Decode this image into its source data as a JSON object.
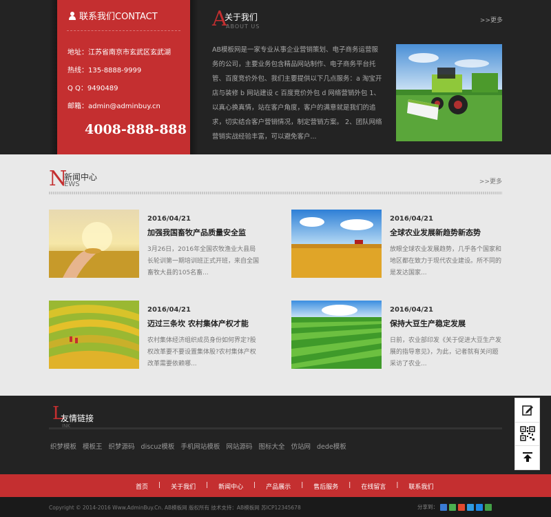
{
  "contact": {
    "title": "联系我们CONTACT",
    "address": "地址：江苏省南京市玄武区玄武湖",
    "hotline_row": "热线：135-8888-9999",
    "qq": "Q Q：9490489",
    "email": "邮箱：admin@adminbuy.cn",
    "phone_big": "4008-888-888"
  },
  "about": {
    "letter": "A",
    "title_cn": "关于我们",
    "title_en": "ABOUT US",
    "more": ">>更多",
    "text": "AB模板网是一家专业从事企业营销策划、电子商务运营服务的公司，主要业务包含精品网站制作、电子商务平台托管、百度竞价外包、我们主要提供以下几点服务：a 淘宝开店与装修 b 网站建设 c 百度竞价外包 d 网络营销外包 1、以真心换真情，站在客户角度，客户的满意就是我们的追求，切实结合客户营销情况，制定营销方案。 2、团队网络营销实战经验丰富，可以避免客户..."
  },
  "news": {
    "letter": "N",
    "title_cn": "新闻中心",
    "title_en": "EWS",
    "more": ">>更多",
    "items": [
      {
        "date": "2016/04/21",
        "title": "加强我国畜牧产品质量安全监",
        "summary": "3月26日，2016年全国农牧渔业大县局长轮训第一期培训班正式开班，来自全国畜牧大县的105名畜..."
      },
      {
        "date": "2016/04/21",
        "title": "全球农业发展新趋势新态势",
        "summary": "放眼全球农业发展趋势，几乎各个国家和地区都在致力于现代农业建设。所不同的是发达国家..."
      },
      {
        "date": "2016/04/21",
        "title": "迈过三条坎 农村集体产权才能",
        "summary": "农村集体经济组织成员身份如何界定?股权改革要不要设置集体股?农村集体产权改革需要依赖哪..."
      },
      {
        "date": "2016/04/21",
        "title": "保持大豆生产稳定发展",
        "summary": "日前，农业部印发《关于促进大豆生产发展的指导意见》，为此，记者就有关问题采访了农业..."
      }
    ]
  },
  "links": {
    "letter": "L",
    "title_cn": "友情链接",
    "title_en": "INK",
    "items": [
      "织梦模板",
      "模板王",
      "织梦源码",
      "discuz模板",
      "手机网站模板",
      "网站源码",
      "图标大全",
      "仿站网",
      "dede模板"
    ]
  },
  "nav": {
    "items": [
      "首页",
      "关于我们",
      "新闻中心",
      "产品展示",
      "售后服务",
      "在线留言",
      "联系我们"
    ]
  },
  "footer": {
    "copyright": "Copyright © 2014-2016 Www.AdminBuy.Cn. AB模板网 版权所有    技术支持：AB模板网    苏ICP12345678",
    "share_label": "分享到："
  },
  "colors": {
    "brand_red": "#c42f30",
    "dark_bg": "#232323",
    "light_bg": "#e9e9e9"
  }
}
